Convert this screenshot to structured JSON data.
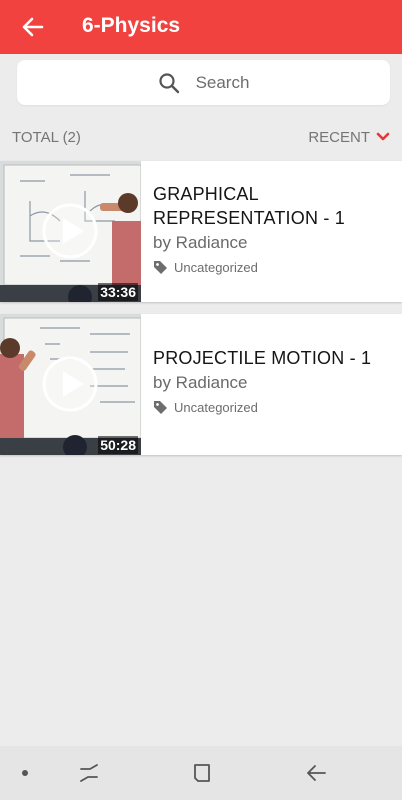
{
  "header": {
    "title": "6-Physics",
    "back_icon": "arrow-left-icon",
    "color": "#f2423f"
  },
  "search": {
    "placeholder": "Search",
    "icon": "search-icon"
  },
  "list_meta": {
    "total_label": "TOTAL (2)",
    "sort_label": "RECENT",
    "sort_icon": "chevron-down-icon",
    "accent": "#e53935"
  },
  "videos": [
    {
      "title": "GRAPHICAL REPRESENTATION - 1",
      "author": "by Radiance",
      "category": "Uncategorized",
      "duration": "33:36"
    },
    {
      "title": "PROJECTILE MOTION - 1",
      "author": "by Radiance",
      "category": "Uncategorized",
      "duration": "50:28"
    }
  ],
  "system_nav": {
    "icons": [
      "dot-icon",
      "recents-icon",
      "home-icon",
      "back-icon"
    ]
  }
}
